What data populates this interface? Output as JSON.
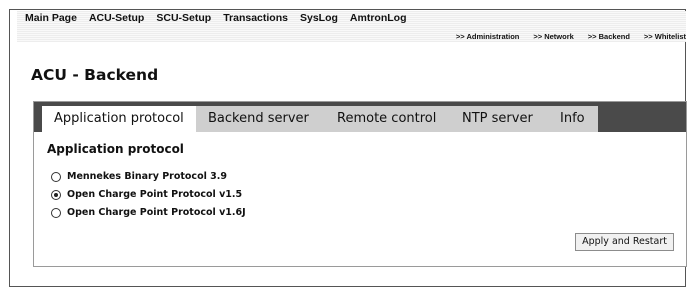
{
  "top_menu": [
    "Main Page",
    "ACU-Setup",
    "SCU-Setup",
    "Transactions",
    "SysLog",
    "AmtronLog"
  ],
  "sub_menu": [
    ">> Administration",
    ">> Network",
    ">> Backend",
    ">> Whitelist"
  ],
  "page_title": "ACU - Backend",
  "tabs": [
    {
      "label": "Application protocol",
      "active": true
    },
    {
      "label": "Backend server",
      "active": false
    },
    {
      "label": "Remote control",
      "active": false
    },
    {
      "label": "NTP server",
      "active": false
    },
    {
      "label": "Info",
      "active": false
    }
  ],
  "section_title": "Application protocol",
  "protocol_options": [
    {
      "label": "Mennekes Binary Protocol 3.9",
      "selected": false
    },
    {
      "label": "Open Charge Point Protocol v1.5",
      "selected": true
    },
    {
      "label": "Open Charge Point Protocol v1.6J",
      "selected": false
    }
  ],
  "apply_button_label": "Apply and Restart"
}
